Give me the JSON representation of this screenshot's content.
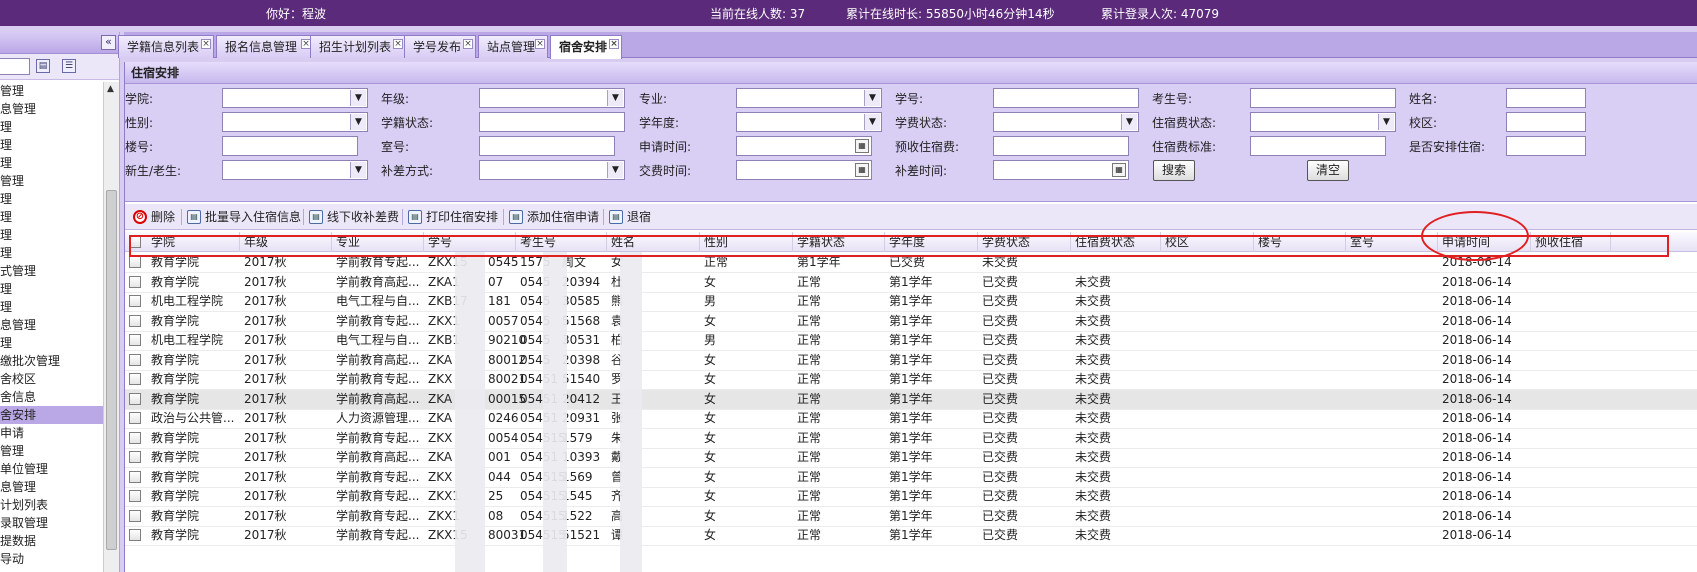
{
  "topbar": {
    "greeting": "你好：程波",
    "online_users": "当前在线人数: 37",
    "online_time": "累计在线时长: 55850小时46分钟14秒",
    "login_count": "累计登录人次: 47079"
  },
  "sidebar": {
    "collapse_glyph": "«",
    "items": [
      "管理",
      "息管理",
      "理",
      "理",
      "理",
      "管理",
      "理",
      "理",
      "理",
      "理",
      "式管理",
      "理",
      "理",
      "息管理",
      "理",
      "缴批次管理",
      "舍校区",
      "舍信息",
      "舍安排",
      "申请",
      "管理",
      "单位管理",
      "息管理",
      "计划列表",
      "录取管理",
      "提数据",
      "导动"
    ],
    "active_index": 18
  },
  "tabs": [
    {
      "label": "学籍信息列表"
    },
    {
      "label": "报名信息管理"
    },
    {
      "label": "招生计划列表"
    },
    {
      "label": "学号发布"
    },
    {
      "label": "站点管理"
    },
    {
      "label": "宿舍安排"
    }
  ],
  "panel": {
    "title": "住宿安排"
  },
  "form": {
    "labels": {
      "college": "学院:",
      "grade": "年级:",
      "major": "专业:",
      "student_no": "学号:",
      "exam_no": "考生号:",
      "name": "姓名:",
      "gender": "性别:",
      "status": "学籍状态:",
      "year": "学年度:",
      "fee_status": "学费状态:",
      "dorm_fee_status": "住宿费状态:",
      "campus": "校区:",
      "building": "楼号:",
      "room": "室号:",
      "apply_time": "申请时间:",
      "prepaid_fee": "预收住宿费:",
      "fee_standard": "住宿费标准:",
      "arranged": "是否安排住宿:",
      "new_old": "新生/老生:",
      "diff_method": "补差方式:",
      "pay_time": "交费时间:",
      "diff_time": "补差时间:"
    },
    "search_button": "搜索",
    "clear_button": "清空"
  },
  "toolbar": {
    "delete": "删除",
    "batch_import": "批量导入住宿信息",
    "offline_fee": "线下收补差费",
    "print": "打印住宿安排",
    "add_apply": "添加住宿申请",
    "checkout": "退宿"
  },
  "grid": {
    "columns": [
      "学院",
      "年级",
      "专业",
      "学号",
      "考生号",
      "姓名",
      "性别",
      "学籍状态",
      "学年度",
      "学费状态",
      "住宿费状态",
      "校区",
      "楼号",
      "室号",
      "申请时间",
      "预收住宿"
    ],
    "rows": [
      [
        "教育学院",
        "2017秋",
        "学前教育专起...",
        "ZKX15",
        "0545",
        "1575",
        "周文",
        "女",
        "正常",
        "第1学年",
        "已交费",
        "未交费",
        "",
        "",
        "",
        "2018-06-14"
      ],
      [
        "教育学院",
        "2017秋",
        "学前教育高起...",
        "ZKA1",
        "07",
        "0545",
        "20394",
        "杜",
        "女",
        "正常",
        "第1学年",
        "已交费",
        "未交费",
        "",
        "",
        "2018-06-14"
      ],
      [
        "机电工程学院",
        "2017秋",
        "电气工程与自...",
        "ZKB17",
        "181",
        "0545",
        "30585",
        "熊",
        "男",
        "正常",
        "第1学年",
        "已交费",
        "未交费",
        "",
        "",
        "2018-06-14"
      ],
      [
        "教育学院",
        "2017秋",
        "学前教育专起...",
        "ZKX1",
        "0057",
        "0545",
        "51568",
        "袁",
        "女",
        "正常",
        "第1学年",
        "已交费",
        "未交费",
        "",
        "",
        "2018-06-14"
      ],
      [
        "机电工程学院",
        "2017秋",
        "电气工程与自...",
        "ZKB1",
        "90210",
        "0545",
        "30531",
        "柏",
        "男",
        "正常",
        "第1学年",
        "已交费",
        "未交费",
        "",
        "",
        "2018-06-14"
      ],
      [
        "教育学院",
        "2017秋",
        "学前教育高起...",
        "ZKA",
        "80012",
        "0545",
        "20398",
        "谷",
        "女",
        "正常",
        "第1学年",
        "已交费",
        "未交费",
        "",
        "",
        "2018-06-14"
      ],
      [
        "教育学院",
        "2017秋",
        "学前教育专起...",
        "ZKX",
        "80021",
        "05451",
        "51540",
        "罗",
        "女",
        "正常",
        "第1学年",
        "已交费",
        "未交费",
        "",
        "",
        "2018-06-14"
      ],
      [
        "教育学院",
        "2017秋",
        "学前教育高起...",
        "ZKA",
        "00015",
        "05451",
        "20412",
        "王",
        "女",
        "正常",
        "第1学年",
        "已交费",
        "未交费",
        "",
        "",
        "2018-06-14"
      ],
      [
        "政治与公共管...",
        "2017秋",
        "人力资源管理...",
        "ZKA",
        "0246",
        "05451",
        "20931",
        "张",
        "女",
        "正常",
        "第1学年",
        "已交费",
        "未交费",
        "",
        "",
        "2018-06-14"
      ],
      [
        "教育学院",
        "2017秋",
        "学前教育专起...",
        "ZKX",
        "0054",
        "054515",
        "1579",
        "朱",
        "女",
        "正常",
        "第1学年",
        "已交费",
        "未交费",
        "",
        "",
        "2018-06-14"
      ],
      [
        "教育学院",
        "2017秋",
        "学前教育高起...",
        "ZKA",
        "001",
        "05451",
        "10393",
        "戴",
        "女",
        "正常",
        "第1学年",
        "已交费",
        "未交费",
        "",
        "",
        "2018-06-14"
      ],
      [
        "教育学院",
        "2017秋",
        "学前教育专起...",
        "ZKX",
        "044",
        "054515",
        "1569",
        "曾",
        "女",
        "正常",
        "第1学年",
        "已交费",
        "未交费",
        "",
        "",
        "2018-06-14"
      ],
      [
        "教育学院",
        "2017秋",
        "学前教育专起...",
        "ZKX1",
        "25",
        "054515",
        "1545",
        "齐",
        "女",
        "正常",
        "第1学年",
        "已交费",
        "未交费",
        "",
        "",
        "2018-06-14"
      ],
      [
        "教育学院",
        "2017秋",
        "学前教育专起...",
        "ZKX1",
        "08",
        "054515",
        "1522",
        "高",
        "女",
        "正常",
        "第1学年",
        "已交费",
        "未交费",
        "",
        "",
        "2018-06-14"
      ],
      [
        "教育学院",
        "2017秋",
        "学前教育专起...",
        "ZKX15",
        "80031",
        "054515",
        "51521",
        "谭",
        "女",
        "正常",
        "第1学年",
        "已交费",
        "未交费",
        "",
        "",
        "2018-06-14"
      ]
    ]
  },
  "colors": {
    "topbar": "#5b2a7a",
    "panel_bg": "#d9cff5",
    "annotation": "#e02020"
  }
}
